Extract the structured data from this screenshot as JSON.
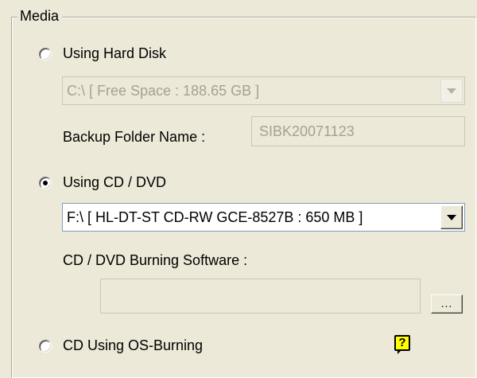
{
  "group": {
    "title": "Media"
  },
  "options": {
    "hard_disk": {
      "label": "Using Hard Disk",
      "selected": false
    },
    "cd_dvd": {
      "label": "Using CD / DVD",
      "selected": true
    },
    "os_burning": {
      "label": "CD Using OS-Burning",
      "selected": false
    }
  },
  "hard_disk": {
    "drive_selected": "C:\\ [ Free Space : 188.65 GB ]",
    "folder_label": "Backup Folder Name :",
    "folder_value": "SIBK20071123"
  },
  "cd_dvd": {
    "drive_selected": "F:\\ [ HL-DT-ST CD-RW GCE-8527B  : 650 MB ]",
    "software_label": "CD / DVD Burning Software :",
    "software_value": "",
    "browse_label": "..."
  },
  "help": {
    "icon_text": "?"
  },
  "colors": {
    "background": "#ece9d8",
    "disabled_text": "#a6a293",
    "help_icon": "#ffff00"
  }
}
